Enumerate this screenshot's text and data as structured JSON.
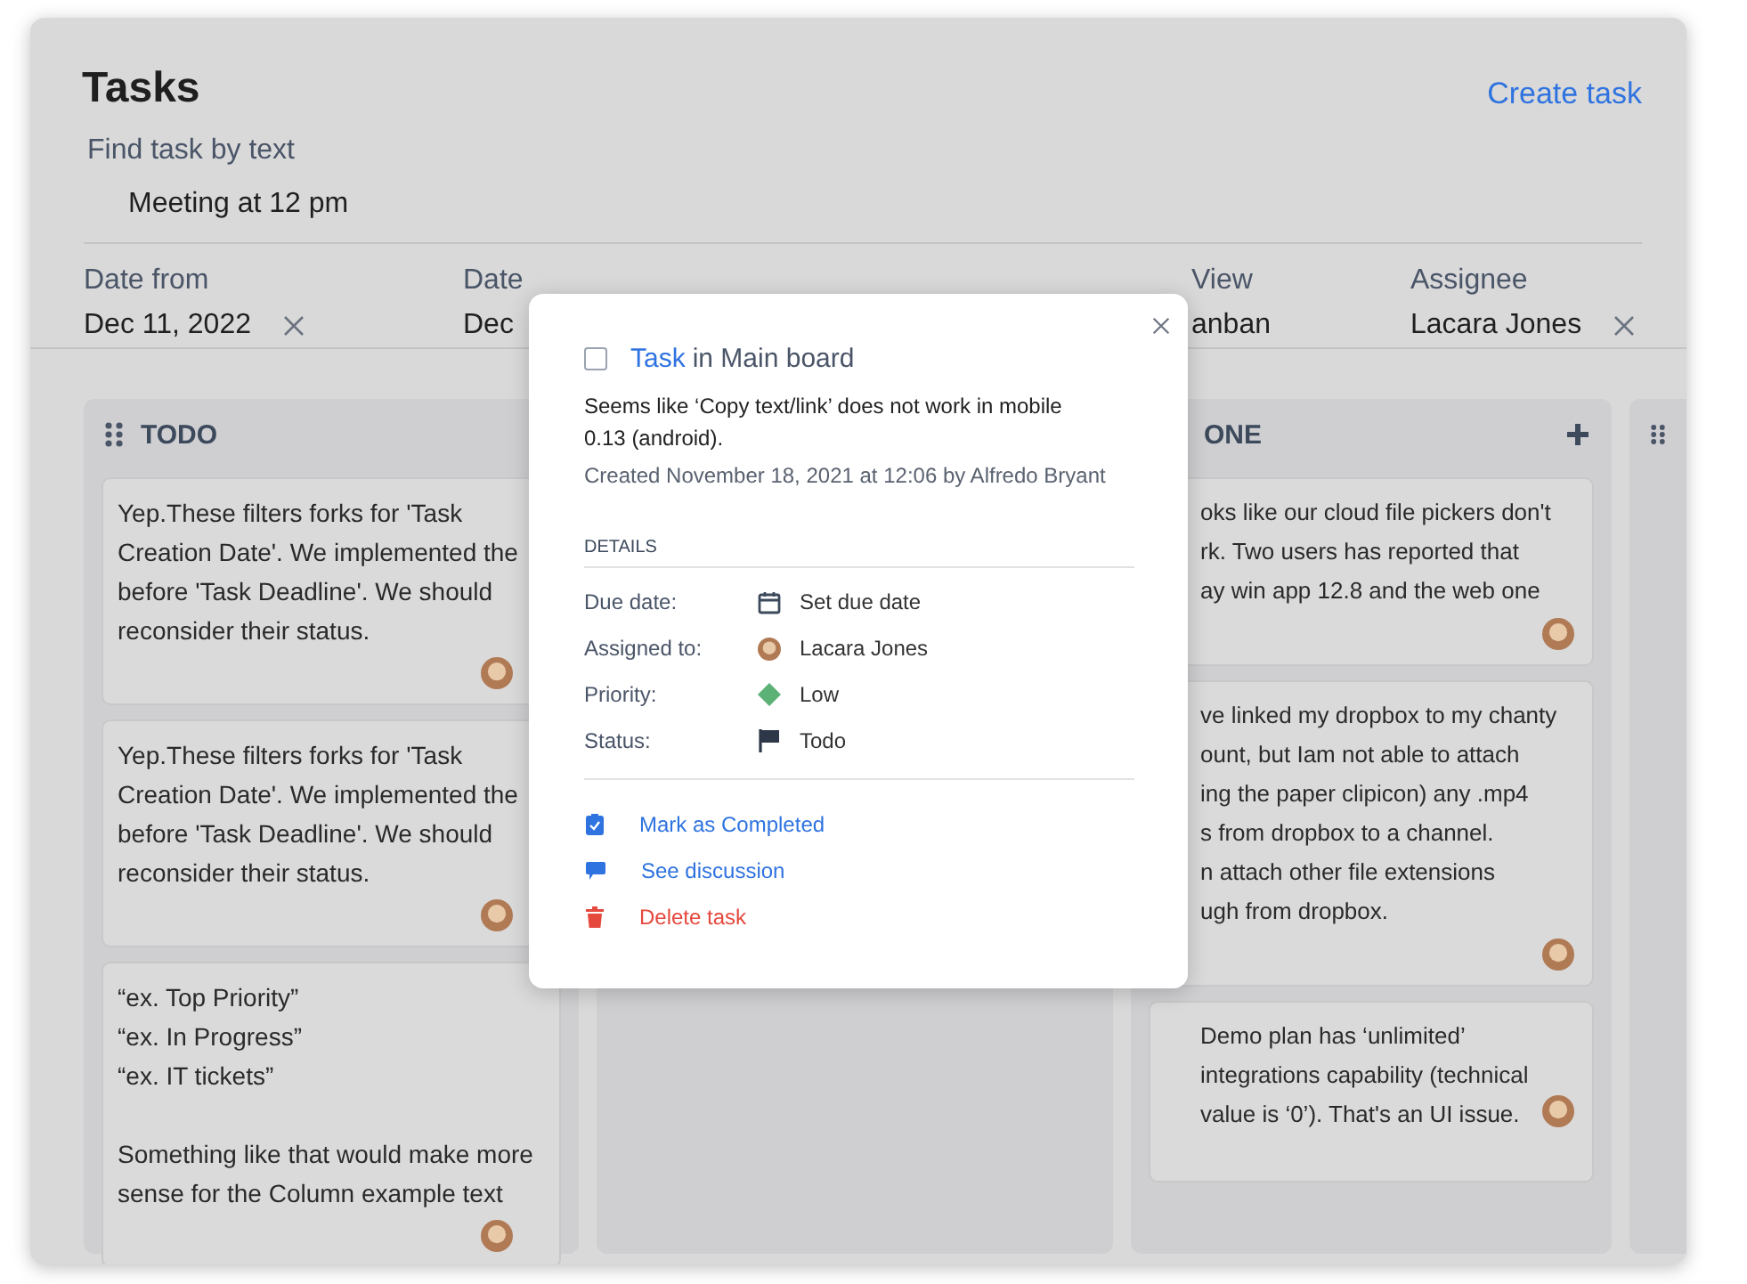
{
  "header": {
    "title": "Tasks",
    "create_link": "Create task"
  },
  "search": {
    "label": "Find task by text",
    "value": "Meeting at 12 pm"
  },
  "filters": [
    {
      "label": "Date from",
      "value": "Dec 11, 2022",
      "clearable": true
    },
    {
      "label": "Date",
      "value": "Dec",
      "clearable": false
    },
    {
      "label": "View",
      "value": "anban",
      "clearable": false
    },
    {
      "label": "Assignee",
      "value": "Lacara Jones",
      "clearable": true
    }
  ],
  "columns": [
    {
      "title": "TODO",
      "kind": "open",
      "handle": true,
      "add": false,
      "cards": [
        {
          "text": "Yep.These filters forks for 'Task\nCreation Date'. We implemented the\nbefore 'Task Deadline'. We should\nreconsider their status.",
          "avatar": true,
          "kind": "bottom"
        },
        {
          "text": "Yep.These filters forks for 'Task\nCreation Date'. We implemented the\nbefore 'Task Deadline'. We should\nreconsider their status.",
          "avatar": true,
          "kind": "bottom"
        },
        {
          "text": "“ex. Top Priority”\n“ex. In Progress”\n“ex. IT tickets”\n\nSomething like that would make more\nsense for the Column example text",
          "avatar": true,
          "kind": "bottom"
        }
      ]
    },
    {
      "kind": "open",
      "handle": false,
      "add": false
    },
    {
      "title": "ONE",
      "kind": "covered",
      "handle": false,
      "add": true,
      "cards": [
        {
          "text": "oks like our cloud file pickers don't\nrk. Two users has reported that\nay win app 12.8 and the web one",
          "avatar": true,
          "kind": "bottom"
        },
        {
          "text": "ve linked my dropbox to my chanty\nount, but Iam not able to attach\ning the paper clipicon) any .mp4\ns from dropbox to a channel.\nn attach other file extensions\nugh from dropbox.",
          "avatar": true,
          "kind": "bottom"
        },
        {
          "text": "Demo plan has ‘unlimited’\nintegrations capability (technical\nvalue is ‘0’). That's an UI issue.",
          "avatar": true,
          "kind": "side"
        }
      ]
    },
    {
      "kind": "open",
      "handle": true,
      "add": false
    }
  ],
  "dialog": {
    "checked": false,
    "title_link": "Task",
    "title_rest": "in Main board",
    "description": "Seems like ‘Copy text/link’ does not work in mobile\n0.13 (android).",
    "created": "Created November 18, 2021 at 12:06 by Alfredo Bryant",
    "details_heading": "DETAILS",
    "details": [
      {
        "label": "Due date:",
        "kind": "calendar",
        "value": "Set due date"
      },
      {
        "label": "Assigned to:",
        "kind": "avatar",
        "value": "Lacara Jones"
      },
      {
        "label": "Priority:",
        "kind": "diamond",
        "color": "#5cb176",
        "value": "Low"
      },
      {
        "label": "Status:",
        "kind": "flag",
        "value": "Todo"
      }
    ],
    "actions": [
      {
        "label": "Mark as Completed",
        "kind": "complete"
      },
      {
        "label": "See discussion",
        "kind": "discussion"
      },
      {
        "label": "Delete task",
        "kind": "delete"
      }
    ]
  }
}
